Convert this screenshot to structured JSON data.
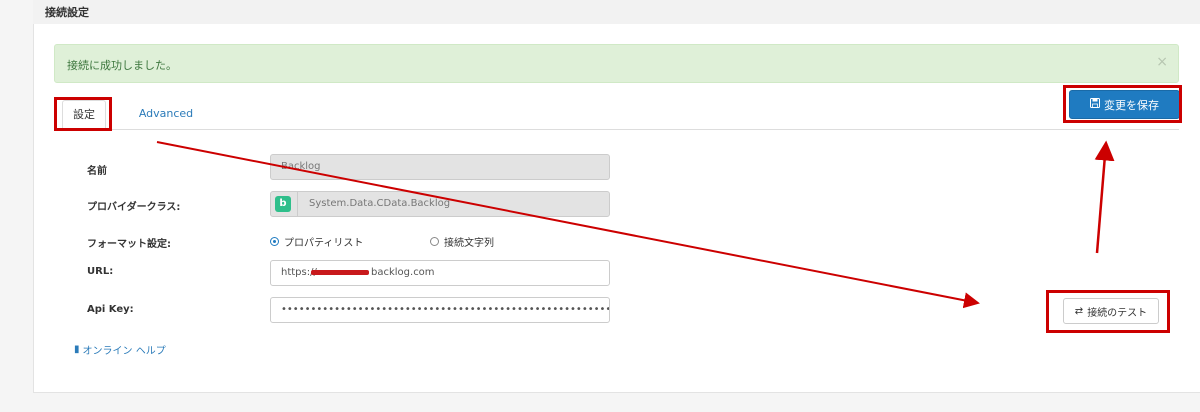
{
  "header": {
    "title": "接続設定"
  },
  "alert": {
    "message": "接続に成功しました。",
    "close": "×"
  },
  "tabs": [
    {
      "label": "設定"
    },
    {
      "label": "Advanced"
    }
  ],
  "toolbar": {
    "save_label": "変更を保存",
    "save_icon": "floppy-disk-icon"
  },
  "form": {
    "name": {
      "label": "名前",
      "value": "Backlog"
    },
    "provider": {
      "label": "プロバイダークラス:",
      "value": "System.Data.CData.Backlog",
      "icon_glyph": "b"
    },
    "format": {
      "label": "フォーマット設定:",
      "options": [
        "プロパティリスト",
        "接続文字列"
      ],
      "selected": "プロパティリスト"
    },
    "url": {
      "label": "URL:",
      "prefix": "https://",
      "suffix": "backlog.com"
    },
    "api_key": {
      "label": "Api Key:",
      "value": "••••••••••••••••••••••••••••••••••••••••••••••••••••••••••••••"
    }
  },
  "test_button": {
    "label": "接続のテスト",
    "icon": "swap-arrows-icon"
  },
  "help": {
    "label": "オンライン ヘルプ",
    "icon": "book-icon"
  },
  "colors": {
    "accent": "#1f7bc1",
    "annotation": "#cc0000",
    "success_bg": "#dff0d8"
  }
}
